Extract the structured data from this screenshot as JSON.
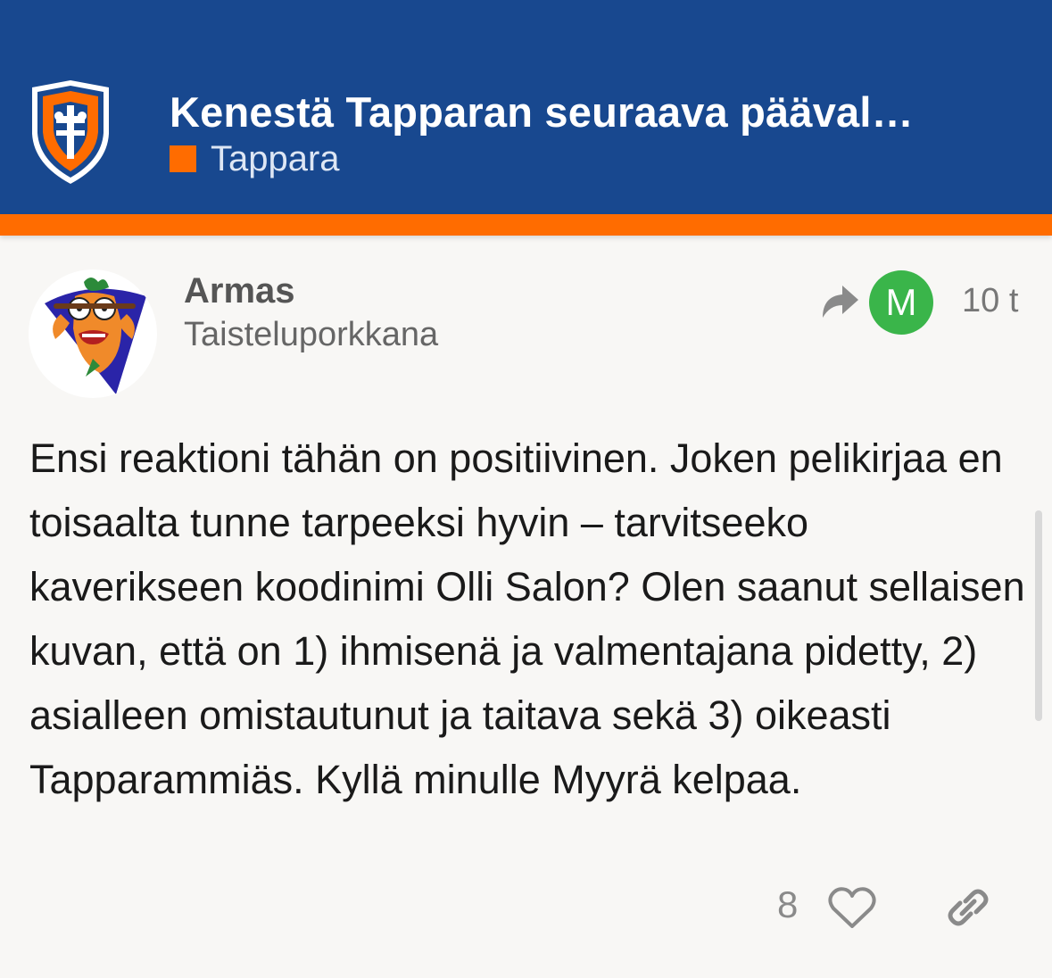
{
  "header": {
    "topic_title": "Kenestä Tapparan seuraava pääval…",
    "category": {
      "name": "Tappara",
      "color": "#ff6c00"
    },
    "background_color": "#18488f",
    "stripe_color": "#ff6c00",
    "logo_icon": "tappara-logo-icon"
  },
  "post": {
    "author": {
      "name": "Armas",
      "title": "Taisteluporkkana",
      "avatar_icon": "carrot-mascot-avatar"
    },
    "reply_to": {
      "avatar_letter": "M",
      "avatar_color": "#3ab54a"
    },
    "time": "10 t",
    "body": "Ensi reaktioni tähän on positiivinen. Joken pelikirjaa en toisaalta tunne tarpeeksi hyvin – tarvitseeko kaverikseen koodinimi Olli Salon? Olen saanut sellaisen kuvan, että on 1) ihmisenä ja valmentajana pidetty, 2) asialleen omistautunut ja taitava sekä 3) oikeasti Tapparammiäs. Kyllä minulle Myyrä kelpaa.",
    "actions": {
      "like_count": "8",
      "like_icon": "heart-icon",
      "share_icon": "link-icon"
    }
  }
}
